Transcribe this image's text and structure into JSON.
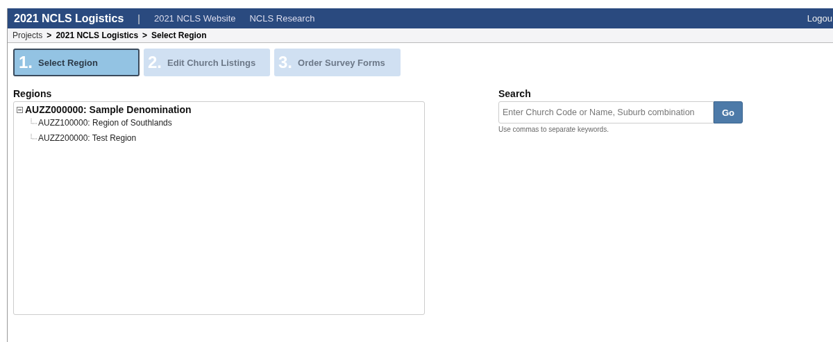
{
  "nav": {
    "brand": "2021 NCLS Logistics",
    "separator": "|",
    "links": [
      "2021 NCLS Website",
      "NCLS Research"
    ],
    "logout": "Logou"
  },
  "breadcrumb": {
    "separator": ">",
    "items": [
      "Projects",
      "2021 NCLS Logistics",
      "Select Region"
    ]
  },
  "steps": [
    {
      "number": "1.",
      "label": "Select Region",
      "selected": true
    },
    {
      "number": "2.",
      "label": "Edit Church Listings",
      "selected": false
    },
    {
      "number": "3.",
      "label": "Order Survey Forms",
      "selected": false
    }
  ],
  "regions": {
    "title": "Regions",
    "tree": [
      {
        "label": "AUZZ000000: Sample Denomination",
        "expanded": true,
        "children": [
          {
            "label": "AUZZ100000: Region of Southlands"
          },
          {
            "label": "AUZZ200000: Test Region"
          }
        ]
      }
    ]
  },
  "search": {
    "title": "Search",
    "placeholder": "Enter Church Code or Name, Suburb combination",
    "button": "Go",
    "hint": "Use commas to separate keywords."
  }
}
